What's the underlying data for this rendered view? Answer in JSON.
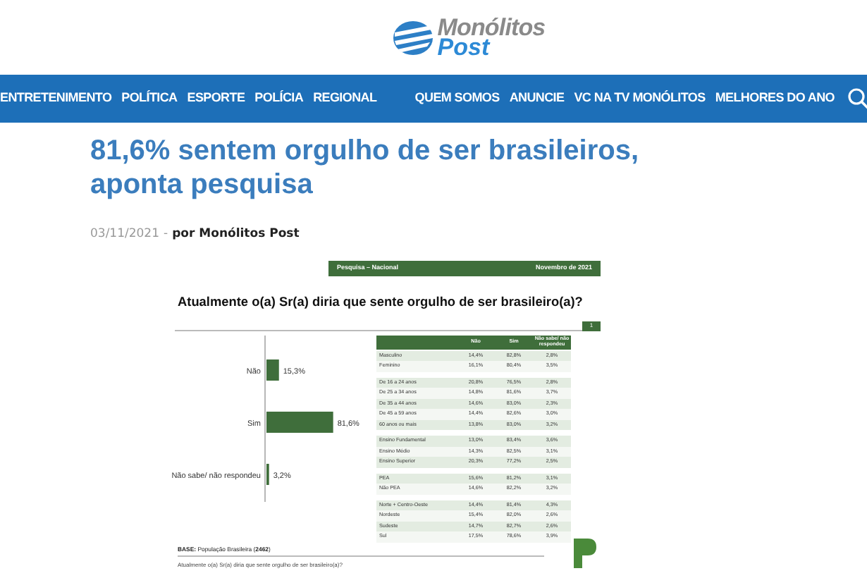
{
  "logo": {
    "line_1": "Monólitos",
    "line_2": "Post"
  },
  "nav": {
    "left": [
      "ENTRETENIMENTO",
      "POLÍTICA",
      "ESPORTE",
      "POLÍCIA",
      "REGIONAL"
    ],
    "right": [
      "QUEM SOMOS",
      "ANUNCIE",
      "VC NA TV MONÓLITOS",
      "MELHORES DO ANO"
    ]
  },
  "article": {
    "title": "81,6% sentem orgulho de ser brasileiros, aponta pesquisa",
    "date": "03/11/2021",
    "separator": "-",
    "author": "por Monólitos Post"
  },
  "figure": {
    "banner_left": "Pesquisa – Nacional",
    "banner_right": "Novembro de 2021",
    "question": "Atualmente o(a) Sr(a) diria que sente orgulho de ser brasileiro(a)?",
    "page": "1",
    "chart_data": {
      "type": "bar",
      "orientation": "horizontal",
      "categories": [
        "Não",
        "Sim",
        "Não sabe/ não respondeu"
      ],
      "values": [
        15.3,
        81.6,
        3.2
      ],
      "value_labels": [
        "15,3%",
        "81,6%",
        "3,2%"
      ]
    },
    "table": {
      "columns": [
        "Não",
        "Sim",
        "Não sabe/ não respondeu"
      ],
      "groups": [
        [
          [
            "Masculino",
            "14,4%",
            "82,8%",
            "2,8%"
          ],
          [
            "Feminino",
            "16,1%",
            "80,4%",
            "3,5%"
          ]
        ],
        [
          [
            "De 16 a 24 anos",
            "20,8%",
            "76,5%",
            "2,8%"
          ],
          [
            "De 25 a 34 anos",
            "14,8%",
            "81,6%",
            "3,7%"
          ],
          [
            "De 35 a 44 anos",
            "14,6%",
            "83,0%",
            "2,3%"
          ],
          [
            "De 45 a 59 anos",
            "14,4%",
            "82,6%",
            "3,0%"
          ],
          [
            "60 anos ou mais",
            "13,8%",
            "83,0%",
            "3,2%"
          ]
        ],
        [
          [
            "Ensino Fundamental",
            "13,0%",
            "83,4%",
            "3,6%"
          ],
          [
            "Ensino Médio",
            "14,3%",
            "82,5%",
            "3,1%"
          ],
          [
            "Ensino Superior",
            "20,3%",
            "77,2%",
            "2,5%"
          ]
        ],
        [
          [
            "PEA",
            "15,6%",
            "81,2%",
            "3,1%"
          ],
          [
            "Não PEA",
            "14,6%",
            "82,2%",
            "3,2%"
          ]
        ],
        [
          [
            "Norte + Centro-Oeste",
            "14,4%",
            "81,4%",
            "4,3%"
          ],
          [
            "Nordeste",
            "15,4%",
            "82,0%",
            "2,6%"
          ],
          [
            "Sudeste",
            "14,7%",
            "82,7%",
            "2,6%"
          ],
          [
            "Sul",
            "17,5%",
            "78,6%",
            "3,9%"
          ]
        ]
      ]
    },
    "base": "**BASE:** População Brasileira (**2462**)",
    "footnote": "Atualmente o(a) Sr(a) diria que sente orgulho de ser brasileiro(a)?"
  }
}
